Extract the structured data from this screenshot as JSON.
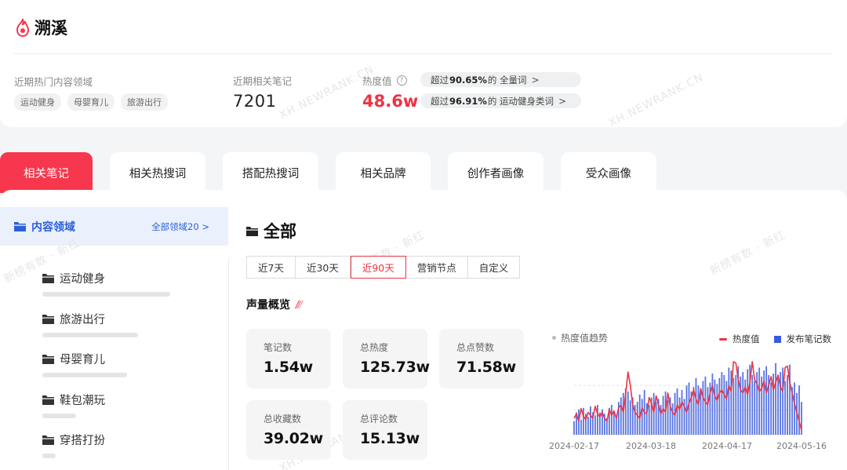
{
  "brand": {
    "name": "溯溪",
    "color": "#f7374d"
  },
  "summary": {
    "domain_label": "近期热门内容领域",
    "domain_tags": [
      "运动健身",
      "母婴育儿",
      "旅游出行"
    ],
    "notes_label": "近期相关笔记",
    "notes_value": "7201",
    "heat_label": "热度值",
    "heat_value": "48.6w",
    "heat_color": "#ee3344",
    "exceed": [
      {
        "prefix": "超过",
        "pct": "90.65%",
        "suffix": "的 全量词"
      },
      {
        "prefix": "超过",
        "pct": "96.91%",
        "suffix": "的 运动健身类词"
      }
    ]
  },
  "watermarks": [
    "XH.NEWRANK.CN",
    "新榜有数 · 新红"
  ],
  "tabs": [
    "相关笔记",
    "相关热搜词",
    "搭配热搜词",
    "相关品牌",
    "创作者画像",
    "受众画像"
  ],
  "active_tab": 0,
  "sidebar": {
    "title": "内容领域",
    "all_link": "全部领域20",
    "items": [
      {
        "label": "运动健身",
        "share": 0.68
      },
      {
        "label": "旅游出行",
        "share": 0.51
      },
      {
        "label": "母婴育儿",
        "share": 0.45
      },
      {
        "label": "鞋包潮玩",
        "share": 0.18
      },
      {
        "label": "穿搭打扮",
        "share": 0.07
      }
    ]
  },
  "content": {
    "section_title": "全部",
    "ranges": [
      "近7天",
      "近30天",
      "近90天",
      "营销节点",
      "自定义"
    ],
    "active_range": 2,
    "overview_title": "声量概览",
    "stats": [
      {
        "label": "笔记数",
        "value": "1.54w"
      },
      {
        "label": "总热度",
        "value": "125.73w"
      },
      {
        "label": "总点赞数",
        "value": "71.58w"
      },
      {
        "label": "总收藏数",
        "value": "39.02w"
      },
      {
        "label": "总评论数",
        "value": "15.13w"
      }
    ]
  },
  "chart_data": {
    "type": "bar",
    "title": "热度值趋势",
    "legend_position": "top-right",
    "x_tick_labels": [
      "2024-02-17",
      "2024-03-18",
      "2024-04-17",
      "2024-05-16"
    ],
    "series": [
      {
        "name": "热度值",
        "kind": "line",
        "color": "#ee3344",
        "values": [
          0.22,
          0.28,
          0.18,
          0.35,
          0.25,
          0.2,
          0.3,
          0.26,
          0.22,
          0.38,
          0.28,
          0.24,
          0.3,
          0.22,
          0.18,
          0.34,
          0.26,
          0.32,
          0.22,
          0.36,
          0.4,
          0.3,
          0.55,
          0.84,
          0.66,
          0.4,
          0.3,
          0.26,
          0.22,
          0.36,
          0.3,
          0.28,
          0.5,
          0.42,
          0.3,
          0.52,
          0.4,
          0.28,
          0.35,
          0.3,
          0.56,
          0.38,
          0.3,
          0.26,
          0.4,
          0.34,
          0.44,
          0.38,
          0.3,
          0.42,
          0.5,
          0.6,
          0.48,
          0.4,
          0.62,
          0.5,
          0.44,
          0.4,
          0.56,
          0.66,
          0.52,
          0.46,
          0.56,
          0.6,
          0.54,
          0.48,
          0.66,
          0.58,
          0.98,
          0.96,
          0.74,
          0.6,
          0.56,
          0.64,
          0.54,
          0.7,
          0.98,
          0.74,
          0.68,
          0.58,
          0.62,
          0.72,
          0.56,
          0.66,
          0.78,
          0.6,
          0.7,
          0.8,
          0.64,
          0.58,
          0.9,
          0.92,
          0.7,
          0.56,
          0.42,
          0.3,
          0.18,
          0.06
        ]
      },
      {
        "name": "发布笔记数",
        "kind": "bar",
        "color": "#3b5bdb",
        "values": [
          0.18,
          0.3,
          0.34,
          0.2,
          0.36,
          0.28,
          0.24,
          0.38,
          0.3,
          0.26,
          0.4,
          0.3,
          0.34,
          0.28,
          0.22,
          0.36,
          0.4,
          0.3,
          0.26,
          0.44,
          0.5,
          0.56,
          0.62,
          0.58,
          0.46,
          0.5,
          0.4,
          0.44,
          0.54,
          0.48,
          0.6,
          0.42,
          0.4,
          0.5,
          0.56,
          0.44,
          0.48,
          0.4,
          0.52,
          0.58,
          0.46,
          0.5,
          0.42,
          0.56,
          0.62,
          0.5,
          0.6,
          0.48,
          0.66,
          0.7,
          0.58,
          0.64,
          0.76,
          0.66,
          0.6,
          0.72,
          0.78,
          0.64,
          0.7,
          0.82,
          0.74,
          0.68,
          0.76,
          0.84,
          0.8,
          0.72,
          0.9,
          0.86,
          0.76,
          0.8,
          0.92,
          0.78,
          0.84,
          0.74,
          0.88,
          0.94,
          0.8,
          0.72,
          0.84,
          0.9,
          0.78,
          0.86,
          0.92,
          0.8,
          0.7,
          0.82,
          0.96,
          0.76,
          0.84,
          0.9,
          0.72,
          0.8,
          0.94,
          0.64,
          0.7,
          0.56,
          0.66,
          0.44
        ]
      }
    ],
    "y_relative": true,
    "grid": true
  }
}
